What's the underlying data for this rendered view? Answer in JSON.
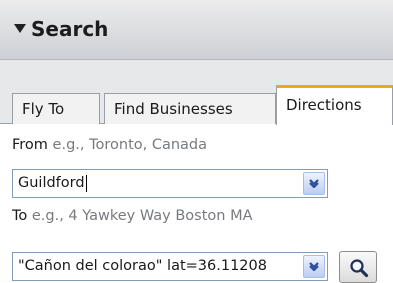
{
  "panel": {
    "title": "Search",
    "collapse_icon": "triangle-down-icon"
  },
  "tabs": [
    {
      "label": "Fly To",
      "active": false
    },
    {
      "label": "Find Businesses",
      "active": false
    },
    {
      "label": "Directions",
      "active": true
    }
  ],
  "directions": {
    "from_label": "From",
    "from_hint": " e.g., Toronto, Canada",
    "from_value": "Guildford",
    "to_label": "To",
    "to_hint": " e.g., 4 Yawkey Way Boston MA",
    "to_value": "\"Cañon del colorao\" lat=36.11208",
    "dropdown_icon": "chevron-down-icon",
    "search_icon": "magnifier-icon"
  },
  "colors": {
    "active_tab_accent": "#f4a31a",
    "dropdown_button": "#bccdf2",
    "hint_text": "#777b80"
  }
}
